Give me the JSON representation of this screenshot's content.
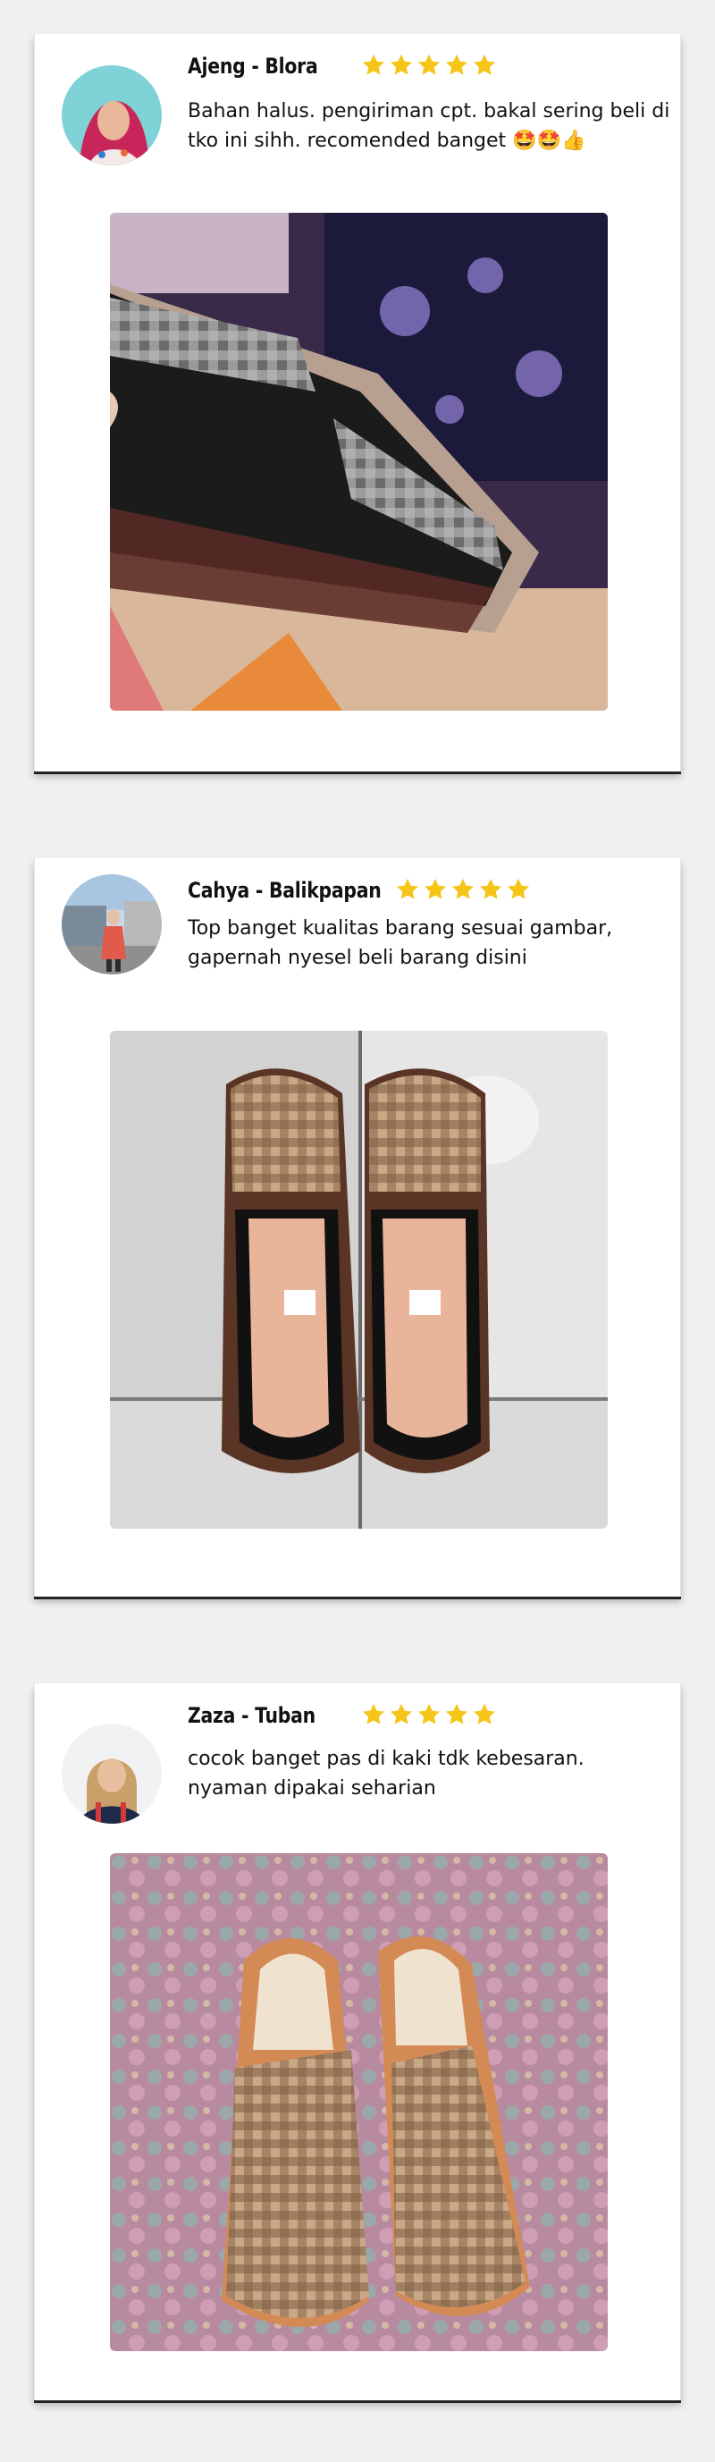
{
  "reviews": [
    {
      "name": "Ajeng - Blora",
      "rating": 5,
      "text": "Bahan halus. pengiriman cpt. bakal sering beli di tko ini sihh. recomended banget 🤩🤩👍"
    },
    {
      "name": "Cahya - Balikpapan",
      "rating": 5,
      "text": "Top banget kualitas barang sesuai gambar, gapernah nyesel beli barang disini"
    },
    {
      "name": "Zaza - Tuban",
      "rating": 5,
      "text": "cocok banget pas di kaki tdk kebesaran. nyaman dipakai seharian"
    }
  ],
  "colors": {
    "star": "#f5c518",
    "card_bg": "#ffffff",
    "page_bg": "#f0f0f0"
  }
}
